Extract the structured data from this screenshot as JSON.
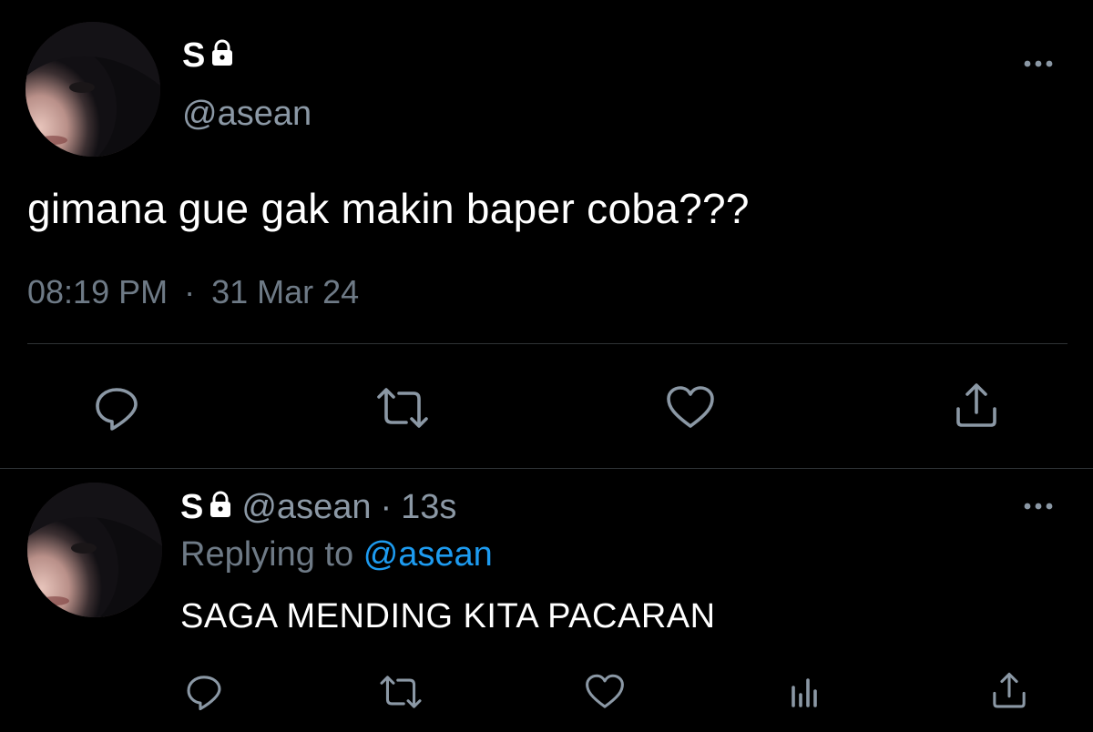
{
  "main_tweet": {
    "author_name": "S",
    "handle": "@asean",
    "text": "gimana gue gak makin baper coba???",
    "time": "08:19 PM",
    "separator": "·",
    "date": "31 Mar 24"
  },
  "reply_tweet": {
    "author_name": "S",
    "handle": "@asean",
    "separator": "·",
    "age": "13s",
    "replying_prefix": "Replying to",
    "replying_to": "@asean",
    "text": "SAGA MENDING KITA PACARAN"
  },
  "icons": {
    "lock": "lock-icon",
    "more": "more-options-icon",
    "reply": "reply-icon",
    "retweet": "retweet-icon",
    "like": "heart-icon",
    "analytics": "analytics-icon",
    "share": "share-icon"
  },
  "colors": {
    "background": "#000000",
    "text_primary": "#ffffff",
    "text_secondary": "#6e7a86",
    "mention": "#1d9bf0",
    "divider": "#2f3336"
  }
}
